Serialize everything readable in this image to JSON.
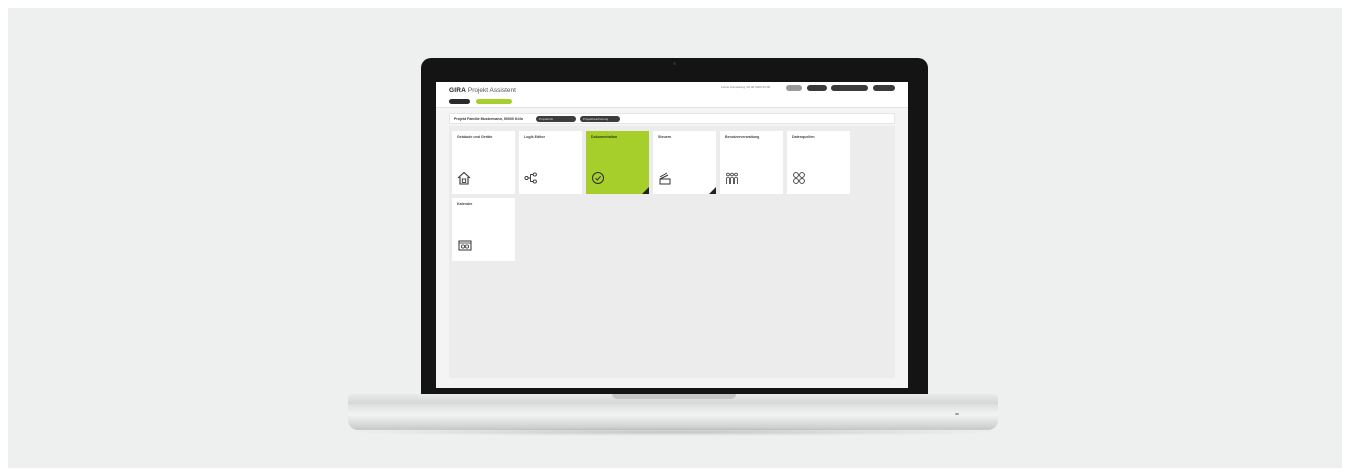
{
  "app": {
    "brand": "GIRA",
    "title": "Projekt Assistent",
    "status_info": "Letzte Anmeldung: 00.00.0000 00:00",
    "header_buttons": [
      "Hilfe",
      "Konto",
      "Anmelden/Abmelden",
      "Menü"
    ]
  },
  "nav": {
    "buttons": [
      {
        "label": "",
        "active": false
      },
      {
        "label": "Projekte",
        "active": true
      }
    ]
  },
  "project": {
    "title": "Projekt Familie Mustermann, 50000 Köln",
    "pills": [
      "Projektinfo",
      "Projektbearbeitung"
    ]
  },
  "tiles": [
    {
      "label": "Gebäude und Geräte",
      "icon": "house-icon",
      "active": false,
      "corner": false
    },
    {
      "label": "Logik Editor",
      "icon": "logic-nodes-icon",
      "active": false,
      "corner": false
    },
    {
      "label": "Dokumentation",
      "icon": "check-circle-icon",
      "active": true,
      "corner": true
    },
    {
      "label": "Steuern",
      "icon": "stack-icon",
      "active": false,
      "corner": true
    },
    {
      "label": "Benutzerverwaltung",
      "icon": "users-icon",
      "active": false,
      "corner": false
    },
    {
      "label": "Datenquellen",
      "icon": "grid-circles-icon",
      "active": false,
      "corner": false
    },
    {
      "label": "Kalender",
      "icon": "calendar-device-icon",
      "active": false,
      "corner": false
    }
  ],
  "colors": {
    "accent": "#a6cf2b",
    "bezel": "#141414",
    "tile": "#ffffff",
    "workspace": "#ececec"
  }
}
